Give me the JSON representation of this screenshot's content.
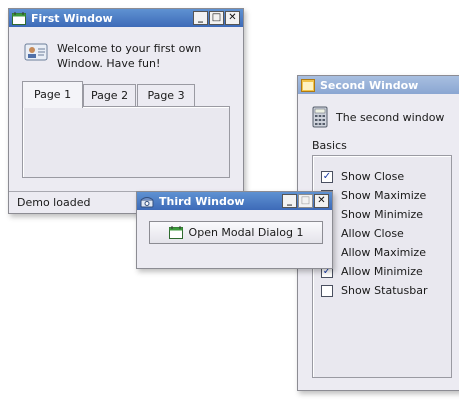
{
  "first_window": {
    "title": "First Window",
    "message": "Welcome to your first own Window. Have fun!",
    "tabs": [
      "Page 1",
      "Page 2",
      "Page 3"
    ],
    "status": "Demo loaded"
  },
  "second_window": {
    "title": "Second Window",
    "heading": "The second window",
    "group_label": "Basics",
    "checkboxes": [
      {
        "label": "Show Close",
        "checked": true
      },
      {
        "label": "Show Maximize",
        "checked": false
      },
      {
        "label": "Show Minimize",
        "checked": false
      },
      {
        "label": "Allow Close",
        "checked": false
      },
      {
        "label": "Allow Maximize",
        "checked": false
      },
      {
        "label": "Allow Minimize",
        "checked": true
      },
      {
        "label": "Show Statusbar",
        "checked": false
      }
    ]
  },
  "third_window": {
    "title": "Third Window",
    "button_label": "Open Modal Dialog 1"
  },
  "titlebar_buttons": {
    "minimize": "_",
    "maximize": "□",
    "close": "✕"
  },
  "colors": {
    "active_title": "#3d6ab8",
    "inactive_title": "#8aa6d2",
    "window_bg": "#ecebf2"
  }
}
